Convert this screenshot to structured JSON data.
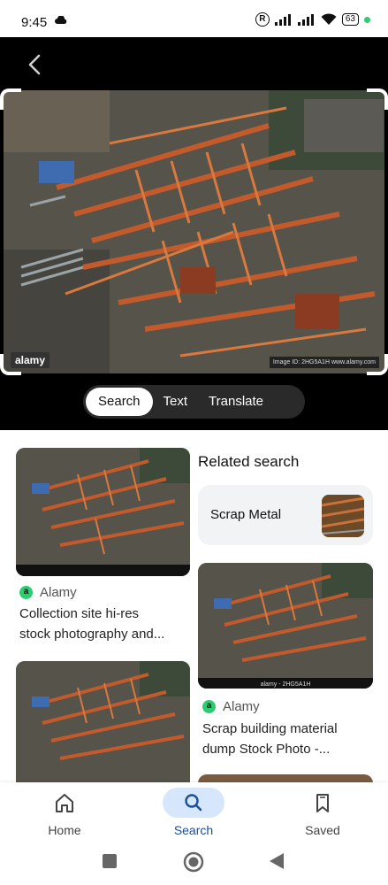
{
  "status_bar": {
    "time": "9:45",
    "registered": "R",
    "battery": "63"
  },
  "lens": {
    "image_source_badge": "alamy",
    "image_id_text": "Image ID: 2HG5A1H\nwww.alamy.com",
    "tabs": [
      {
        "label": "Search",
        "selected": true
      },
      {
        "label": "Text",
        "selected": false
      },
      {
        "label": "Translate",
        "selected": false
      }
    ]
  },
  "results": {
    "left_cards": [
      {
        "source": "Alamy",
        "title_line1": "Collection site hi-res",
        "title_line2": "stock photography and..."
      },
      {
        "source": "",
        "title_line1": "",
        "title_line2": ""
      }
    ],
    "related_heading": "Related search",
    "related_items": [
      {
        "label": "Scrap Metal"
      }
    ],
    "right_cards": [
      {
        "source": "Alamy",
        "title_line1": "Scrap building material",
        "title_line2": "dump Stock Photo -...",
        "caption": "alamy - 2HG5A1H"
      }
    ]
  },
  "bottom_nav": [
    {
      "label": "Home",
      "icon": "home-icon",
      "active": false
    },
    {
      "label": "Search",
      "icon": "search-icon",
      "active": true
    },
    {
      "label": "Saved",
      "icon": "bookmark-icon",
      "active": false
    }
  ],
  "system_nav": [
    "recents-square-icon",
    "home-circle-icon",
    "back-triangle-icon"
  ],
  "colors": {
    "accent": "#1a4f9c",
    "accent_bg": "#d6e6fb",
    "source_dot": "#2ecc71",
    "rust": "#b5542a"
  }
}
